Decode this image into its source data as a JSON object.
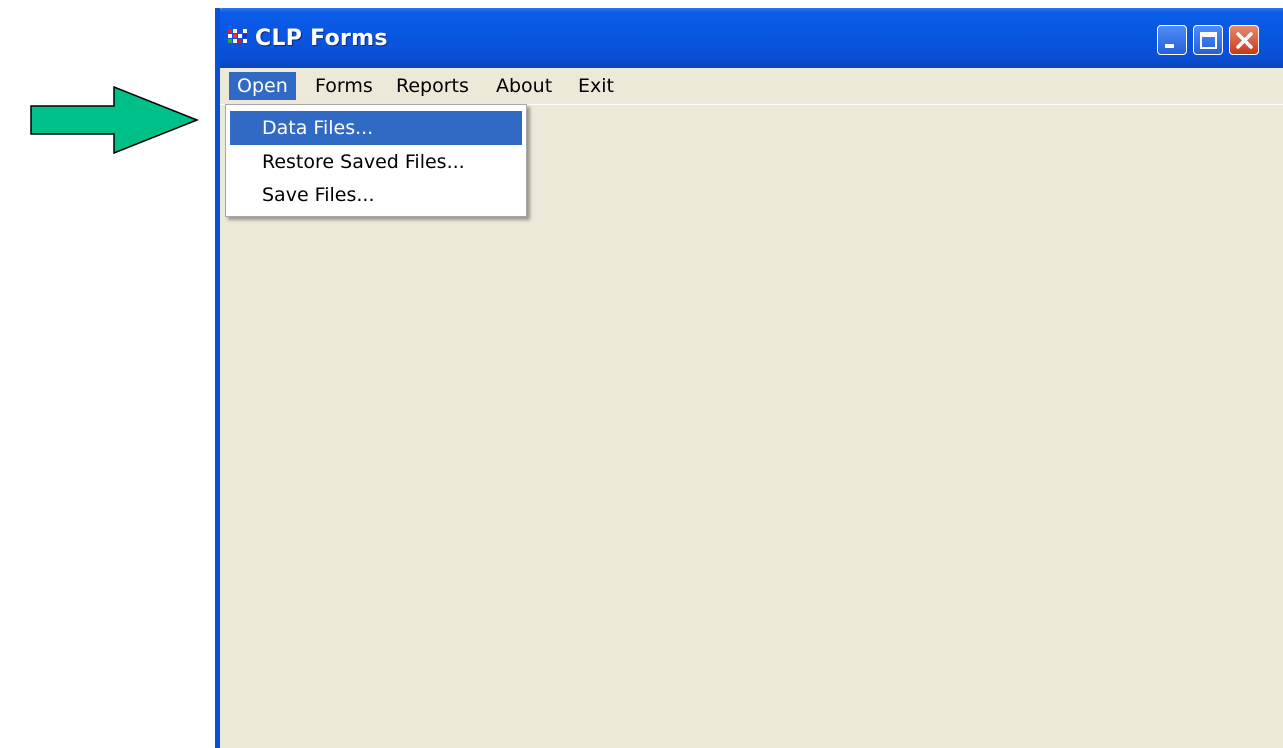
{
  "window": {
    "title": "CLP Forms",
    "app_icon": "clp-app-icon",
    "controls": [
      "minimize-icon",
      "maximize-icon",
      "close-icon"
    ]
  },
  "menubar": {
    "items": [
      {
        "label": "Open",
        "active": true
      },
      {
        "label": "Forms"
      },
      {
        "label": "Reports"
      },
      {
        "label": "About"
      },
      {
        "label": "Exit"
      }
    ]
  },
  "dropdown": {
    "items": [
      {
        "label": "Data Files...",
        "highlighted": true
      },
      {
        "label": "Restore Saved Files..."
      },
      {
        "label": "Save Files..."
      }
    ]
  },
  "annotation": {
    "icon": "green-arrow-icon",
    "color": "#00c08a"
  },
  "colors": {
    "titlebar": "#0a5ce6",
    "menu_highlight": "#316ac5",
    "window_bg": "#ece9d8",
    "close_button": "#d9532c"
  }
}
